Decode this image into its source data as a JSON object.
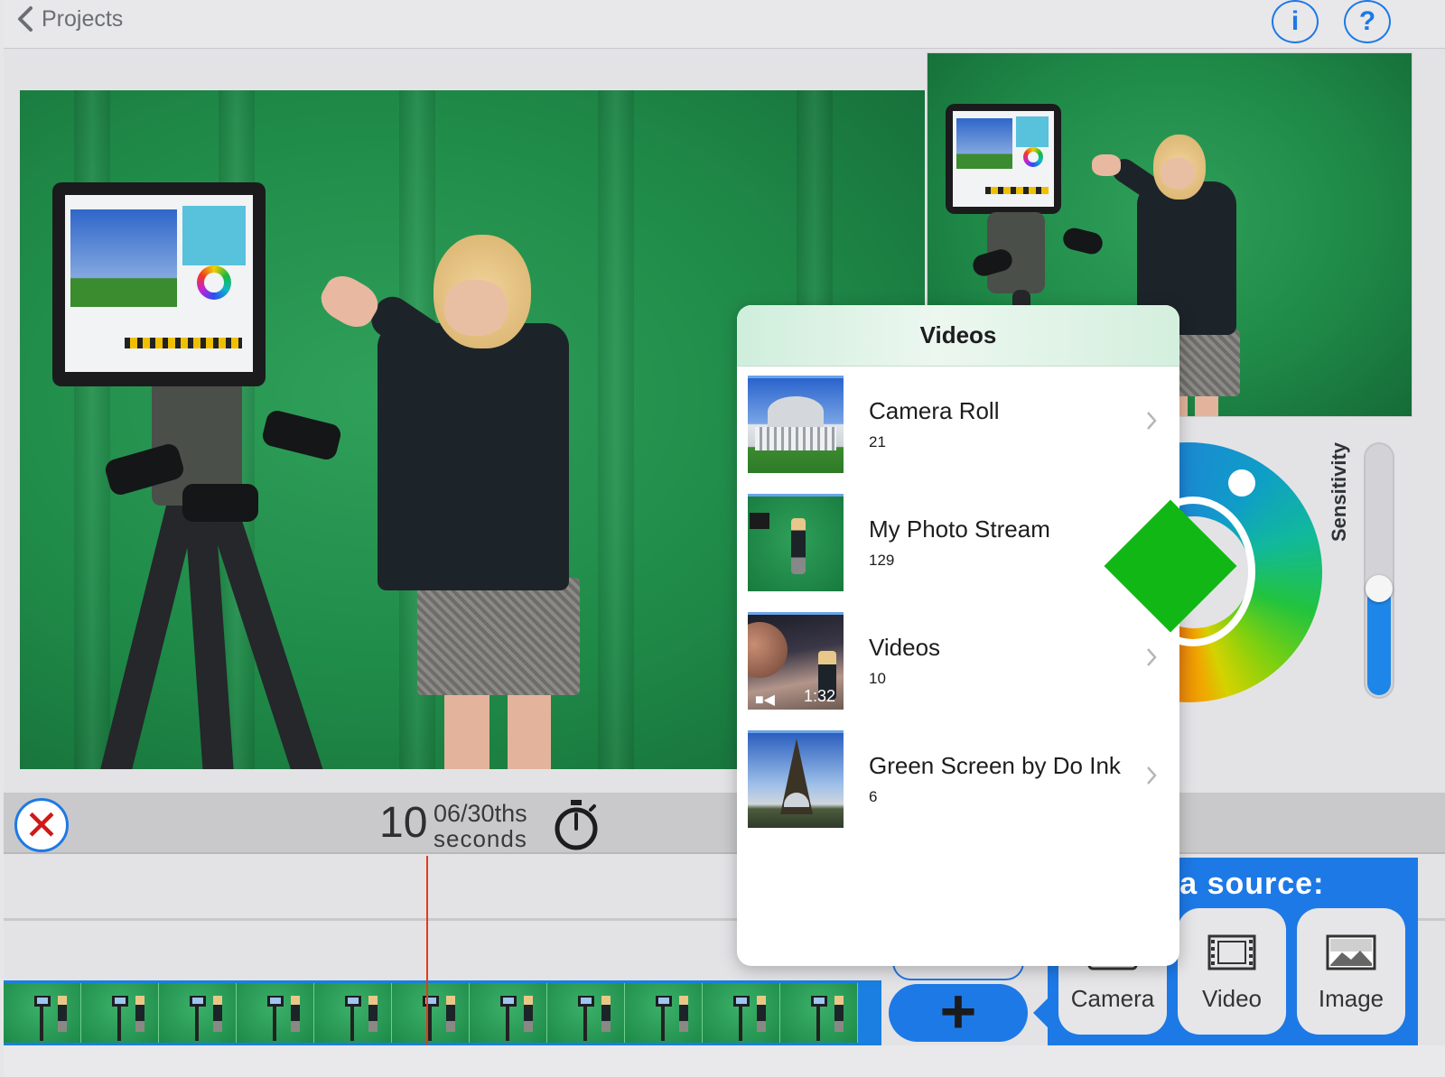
{
  "nav": {
    "back_label": "Projects",
    "info_label": "i",
    "help_label": "?"
  },
  "timer": {
    "seconds": "10",
    "fraction": "06/30ths",
    "unit": "seconds"
  },
  "sensitivity": {
    "label": "Sensitivity",
    "level": 0.42
  },
  "popover": {
    "title": "Videos",
    "albums": [
      {
        "name": "Camera Roll",
        "count": "21"
      },
      {
        "name": "My Photo Stream",
        "count": "129"
      },
      {
        "name": "Videos",
        "count": "10",
        "duration": "1:32"
      },
      {
        "name": "Green Screen by Do Ink",
        "count": "6"
      }
    ]
  },
  "source": {
    "title": "ct a source:",
    "buttons": [
      {
        "label": "Camera"
      },
      {
        "label": "Video"
      },
      {
        "label": "Image"
      }
    ]
  },
  "colors": {
    "accent": "#1d79e6",
    "delete": "#d01818",
    "playhead": "#e23a1e",
    "key_color": "#11b815"
  }
}
